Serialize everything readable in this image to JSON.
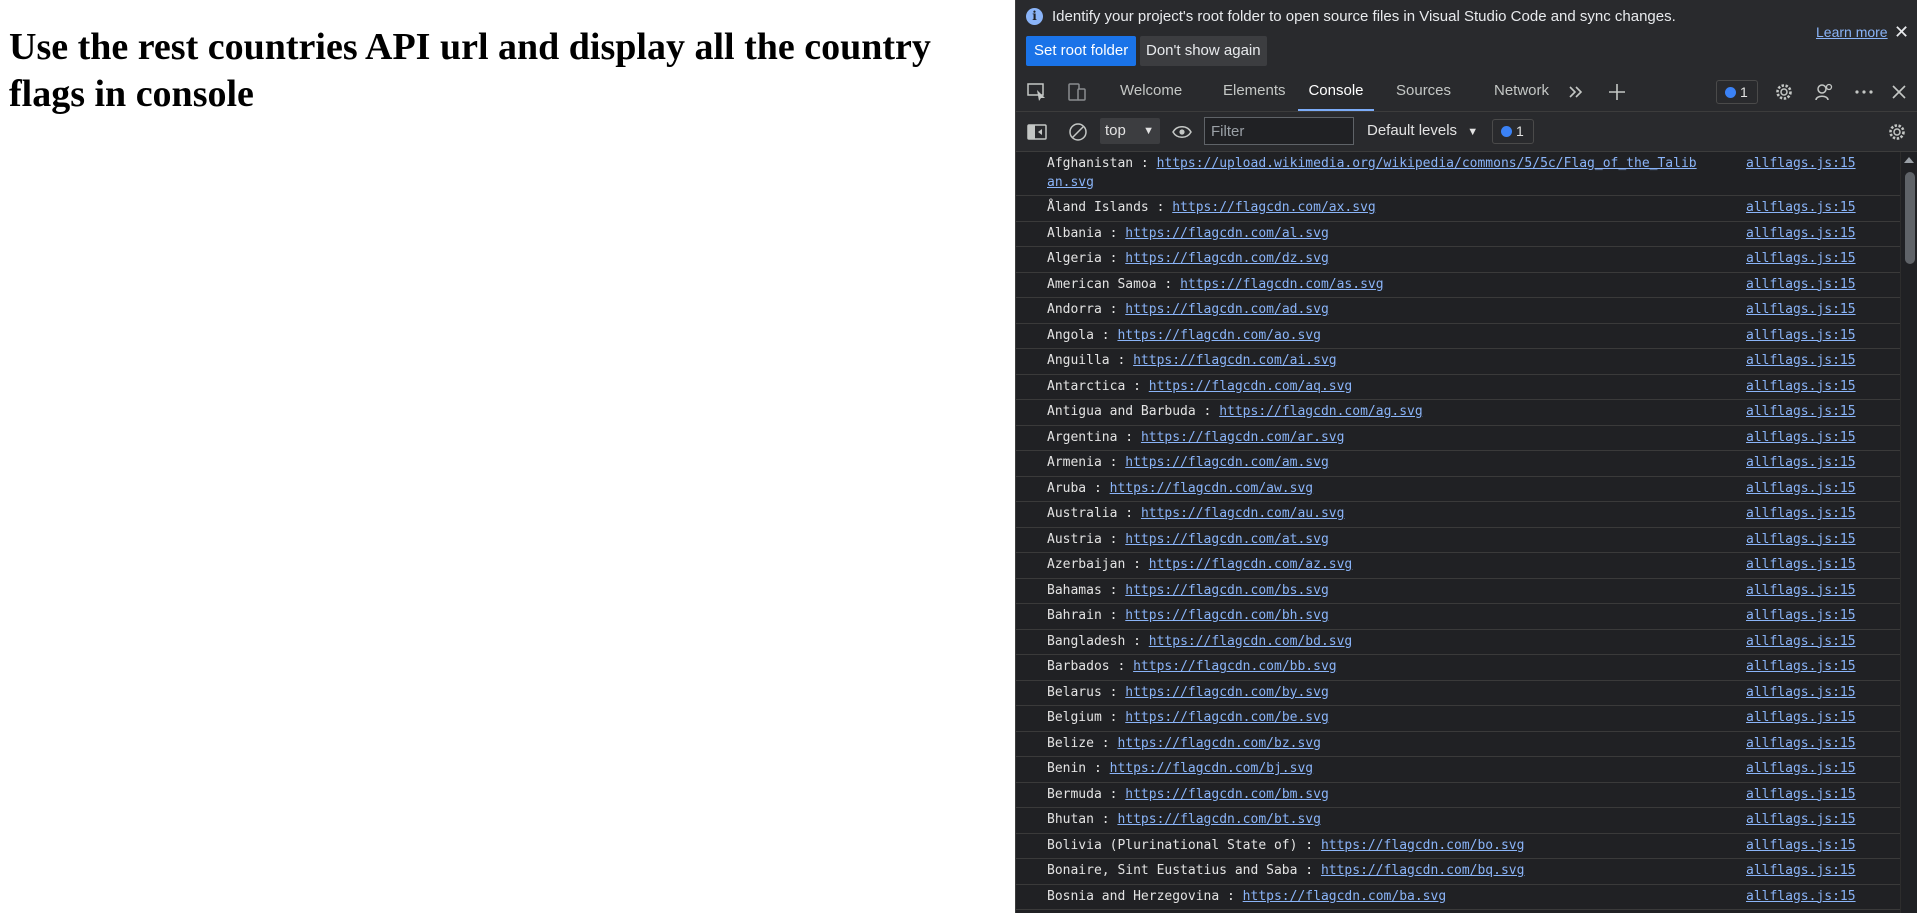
{
  "page": {
    "heading": "Use the rest countries API url and display all the country flags in console"
  },
  "devtools": {
    "infobar": {
      "message": "Identify your project's root folder to open source files in Visual Studio Code and sync changes.",
      "set_root_label": "Set root folder",
      "dont_show_label": "Don't show again",
      "learn_more_label": "Learn more"
    },
    "tabs": [
      {
        "label": "Welcome",
        "active": false
      },
      {
        "label": "Elements",
        "active": false
      },
      {
        "label": "Console",
        "active": true
      },
      {
        "label": "Sources",
        "active": false
      },
      {
        "label": "Network",
        "active": false
      }
    ],
    "issues_count": "1",
    "toolbar": {
      "context": "top",
      "filter_placeholder": "Filter",
      "levels_label": "Default levels",
      "issues_count": "1"
    },
    "colors": {
      "accent": "#1a73e8",
      "link": "#8ab4f8",
      "background": "#202124"
    },
    "console": {
      "rows": [
        {
          "country": "Afghanistan",
          "url": "https://upload.wikimedia.org/wikipedia/commons/5/5c/Flag_of_the_Taliban.svg",
          "source": "allflags.js:15"
        },
        {
          "country": "Åland Islands",
          "url": "https://flagcdn.com/ax.svg",
          "source": "allflags.js:15"
        },
        {
          "country": "Albania",
          "url": "https://flagcdn.com/al.svg",
          "source": "allflags.js:15"
        },
        {
          "country": "Algeria",
          "url": "https://flagcdn.com/dz.svg",
          "source": "allflags.js:15"
        },
        {
          "country": "American Samoa",
          "url": "https://flagcdn.com/as.svg",
          "source": "allflags.js:15"
        },
        {
          "country": "Andorra",
          "url": "https://flagcdn.com/ad.svg",
          "source": "allflags.js:15"
        },
        {
          "country": "Angola",
          "url": "https://flagcdn.com/ao.svg",
          "source": "allflags.js:15"
        },
        {
          "country": "Anguilla",
          "url": "https://flagcdn.com/ai.svg",
          "source": "allflags.js:15"
        },
        {
          "country": "Antarctica",
          "url": "https://flagcdn.com/aq.svg",
          "source": "allflags.js:15"
        },
        {
          "country": "Antigua and Barbuda",
          "url": "https://flagcdn.com/ag.svg",
          "source": "allflags.js:15"
        },
        {
          "country": "Argentina",
          "url": "https://flagcdn.com/ar.svg",
          "source": "allflags.js:15"
        },
        {
          "country": "Armenia",
          "url": "https://flagcdn.com/am.svg",
          "source": "allflags.js:15"
        },
        {
          "country": "Aruba",
          "url": "https://flagcdn.com/aw.svg",
          "source": "allflags.js:15"
        },
        {
          "country": "Australia",
          "url": "https://flagcdn.com/au.svg",
          "source": "allflags.js:15"
        },
        {
          "country": "Austria",
          "url": "https://flagcdn.com/at.svg",
          "source": "allflags.js:15"
        },
        {
          "country": "Azerbaijan",
          "url": "https://flagcdn.com/az.svg",
          "source": "allflags.js:15"
        },
        {
          "country": "Bahamas",
          "url": "https://flagcdn.com/bs.svg",
          "source": "allflags.js:15"
        },
        {
          "country": "Bahrain",
          "url": "https://flagcdn.com/bh.svg",
          "source": "allflags.js:15"
        },
        {
          "country": "Bangladesh",
          "url": "https://flagcdn.com/bd.svg",
          "source": "allflags.js:15"
        },
        {
          "country": "Barbados",
          "url": "https://flagcdn.com/bb.svg",
          "source": "allflags.js:15"
        },
        {
          "country": "Belarus",
          "url": "https://flagcdn.com/by.svg",
          "source": "allflags.js:15"
        },
        {
          "country": "Belgium",
          "url": "https://flagcdn.com/be.svg",
          "source": "allflags.js:15"
        },
        {
          "country": "Belize",
          "url": "https://flagcdn.com/bz.svg",
          "source": "allflags.js:15"
        },
        {
          "country": "Benin",
          "url": "https://flagcdn.com/bj.svg",
          "source": "allflags.js:15"
        },
        {
          "country": "Bermuda",
          "url": "https://flagcdn.com/bm.svg",
          "source": "allflags.js:15"
        },
        {
          "country": "Bhutan",
          "url": "https://flagcdn.com/bt.svg",
          "source": "allflags.js:15"
        },
        {
          "country": "Bolivia (Plurinational State of)",
          "url": "https://flagcdn.com/bo.svg",
          "source": "allflags.js:15"
        },
        {
          "country": "Bonaire, Sint Eustatius and Saba",
          "url": "https://flagcdn.com/bq.svg",
          "source": "allflags.js:15"
        },
        {
          "country": "Bosnia and Herzegovina",
          "url": "https://flagcdn.com/ba.svg",
          "source": "allflags.js:15"
        }
      ]
    }
  }
}
